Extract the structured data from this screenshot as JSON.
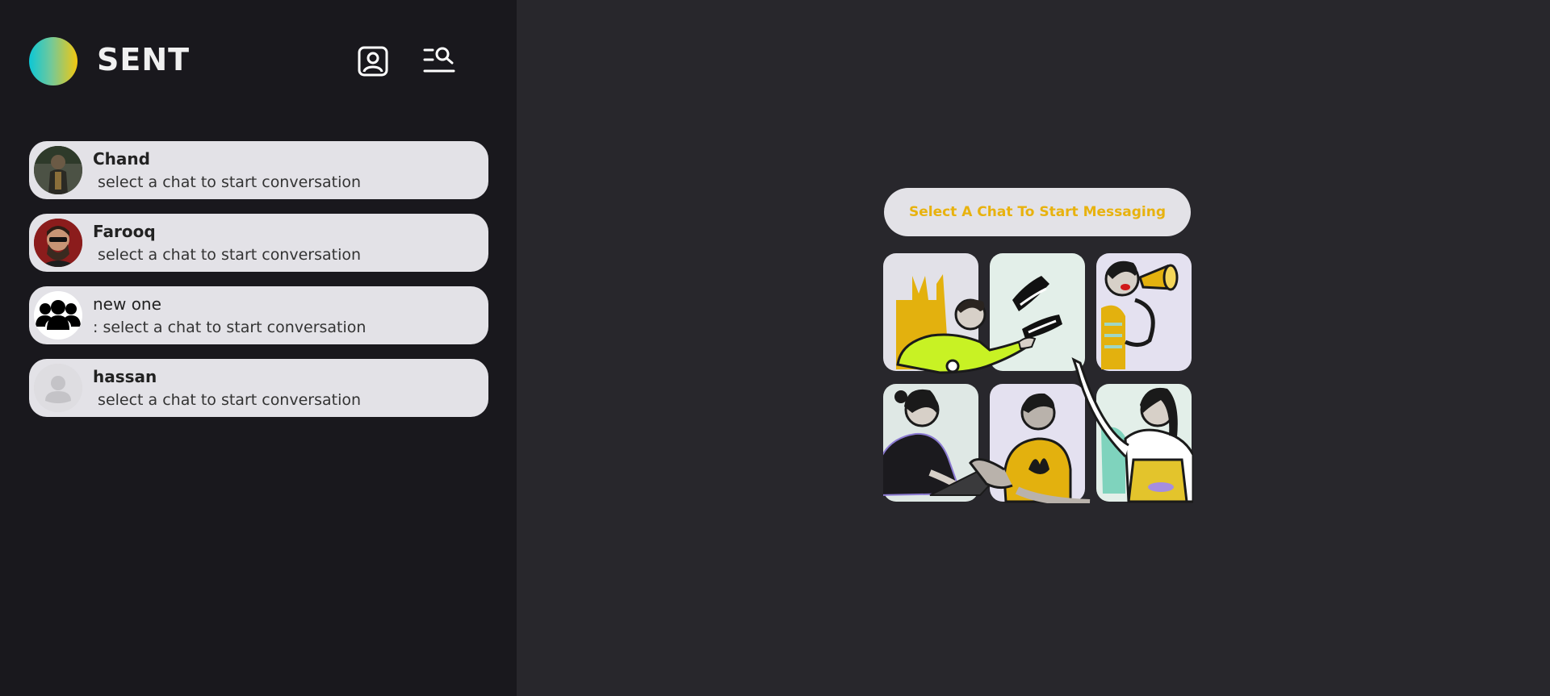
{
  "app": {
    "name": "SENT",
    "logo_colors": [
      "#0cc7d6",
      "#f4c70f"
    ]
  },
  "header": {
    "contacts_icon": "contact-card-icon",
    "search_icon": "list-search-icon"
  },
  "chats": [
    {
      "name": "Chand",
      "message": " select a chat to start conversation",
      "avatar": "photo-avatar-chand"
    },
    {
      "name": "Farooq",
      "message": " select a chat to start conversation",
      "avatar": "photo-avatar-farooq"
    },
    {
      "name": "new one",
      "message": ": select a chat to start conversation",
      "avatar": "group-icon"
    },
    {
      "name": "hassan",
      "message": " select a chat to start conversation",
      "avatar": "default-user-icon"
    }
  ],
  "main": {
    "prompt": "Select A Chat To Start Messaging",
    "accent": "#e8b20e"
  }
}
